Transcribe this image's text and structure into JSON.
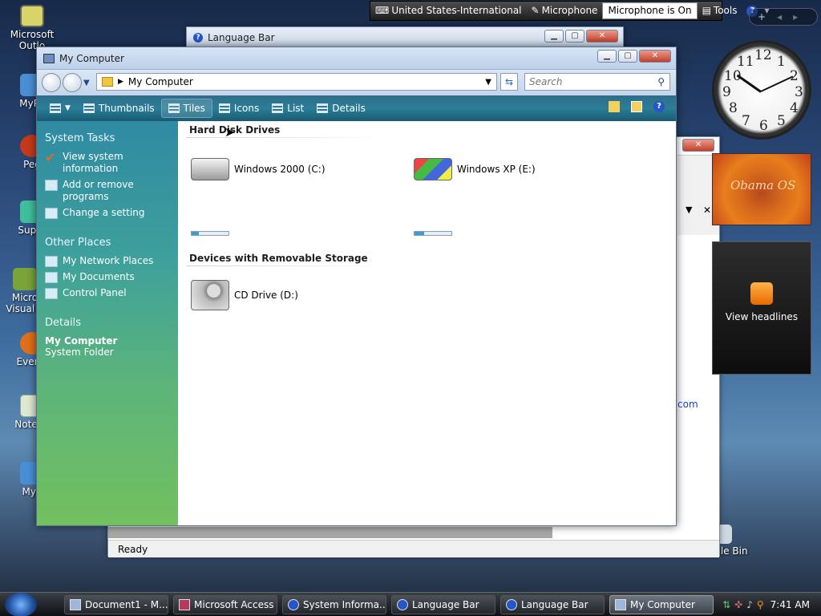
{
  "desktop": {
    "icons": [
      "Microsoft Outlo",
      "MyPa",
      "Peg",
      "Super",
      "Micro Visual S",
      "Everyt",
      "Notepa",
      "Myp"
    ],
    "recycle_bin_label": "Recycle Bin"
  },
  "language_bar": {
    "keyboard": "United States-International",
    "microphone": "Microphone",
    "status": "Microphone is On",
    "tools": "Tools",
    "help": "?"
  },
  "bg_window_1": {
    "title": "Language Bar"
  },
  "bg_window_2": {
    "status": "Ready",
    "link_fragment": "com"
  },
  "main_window": {
    "title": "My Computer",
    "address": "My Computer",
    "search_placeholder": "Search",
    "toolbar": {
      "thumbnails": "Thumbnails",
      "tiles": "Tiles",
      "icons": "Icons",
      "list": "List",
      "details": "Details",
      "help": "?"
    },
    "left_pane": {
      "system_tasks": {
        "heading": "System Tasks",
        "items": [
          "View system information",
          "Add or remove programs",
          "Change a setting"
        ]
      },
      "other_places": {
        "heading": "Other Places",
        "items": [
          "My Network Places",
          "My Documents",
          "Control Panel"
        ]
      },
      "details": {
        "heading": "Details",
        "name": "My Computer",
        "type": "System Folder"
      }
    },
    "content": {
      "group_hard_disks": "Hard Disk Drives",
      "group_removable": "Devices with Removable Storage",
      "drives": [
        {
          "label": "Windows 2000 (C:)",
          "usage": 0.2
        },
        {
          "label": "Windows XP (E:)",
          "usage": 0.25
        },
        {
          "label": "CD Drive (D:)"
        }
      ]
    }
  },
  "sidebar": {
    "clock_numbers": [
      "12",
      "1",
      "2",
      "3",
      "4",
      "5",
      "6",
      "7",
      "8",
      "9",
      "10",
      "11"
    ],
    "photo_caption": "Obama OS",
    "feeds_label": "View headlines"
  },
  "taskbar": {
    "tasks": [
      "Document1 - M...",
      "Microsoft Access",
      "System Informa...",
      "Language Bar",
      "Language Bar",
      "My Computer"
    ],
    "clock": "7:41 AM"
  },
  "colors": {
    "toolbar": "#2a7e98",
    "left_pane_top": "#2f8aa2",
    "left_pane_bottom": "#73c05f"
  }
}
